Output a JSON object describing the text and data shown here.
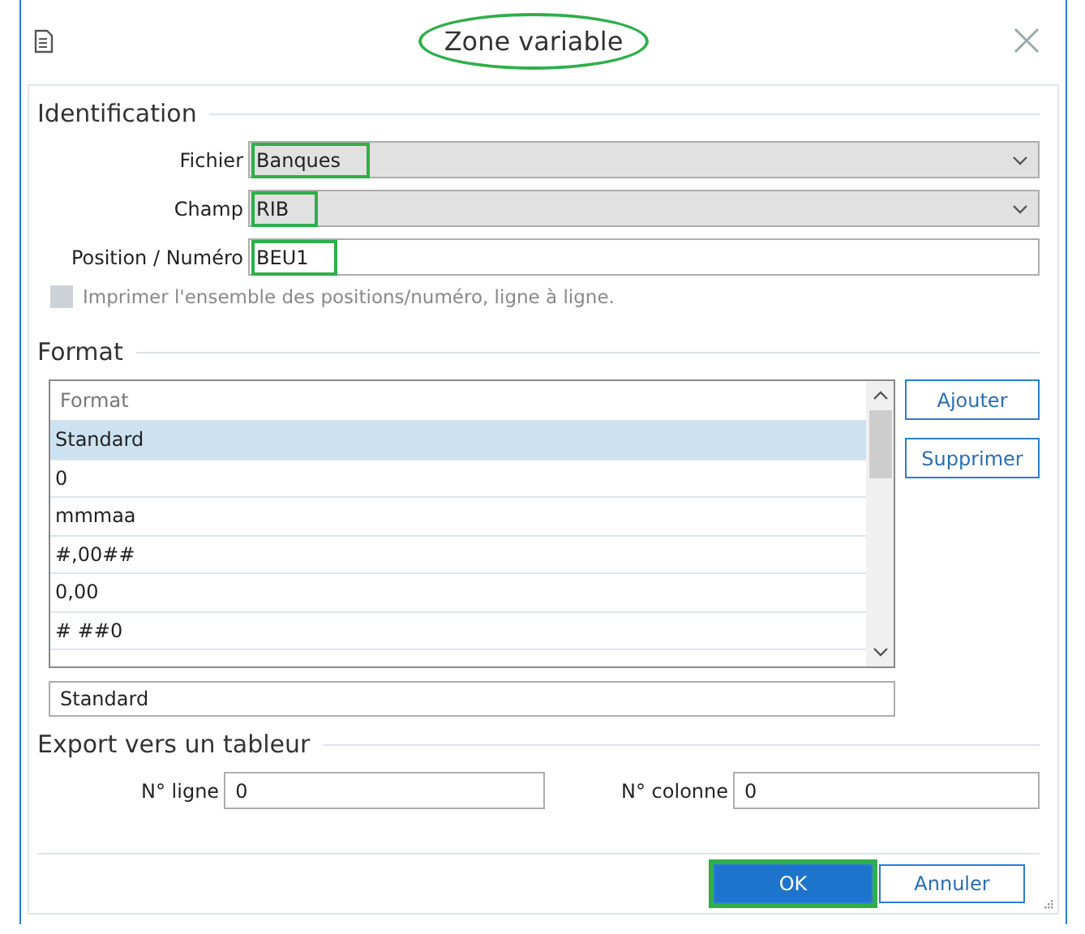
{
  "window": {
    "title": "Zone variable",
    "title_circled": true
  },
  "identification": {
    "heading": "Identification",
    "fields": [
      {
        "kind": "combo",
        "label": "Fichier",
        "value": "Banques",
        "highlighted": true
      },
      {
        "kind": "combo",
        "label": "Champ",
        "value": "RIB",
        "highlighted": true
      },
      {
        "kind": "text",
        "label": "Position / Numéro",
        "value": "BEU1",
        "highlighted": true
      }
    ],
    "checkbox": {
      "label": "Imprimer l'ensemble des positions/numéro, ligne à ligne.",
      "checked": false,
      "disabled": true
    }
  },
  "format": {
    "heading": "Format",
    "list_header": "Format",
    "rows": [
      {
        "text": "Standard",
        "selected": true
      },
      {
        "text": "0",
        "selected": false
      },
      {
        "text": "mmmaa",
        "selected": false
      },
      {
        "text": "#,00##",
        "selected": false
      },
      {
        "text": "0,00",
        "selected": false
      },
      {
        "text": "# ##0",
        "selected": false
      }
    ],
    "buttons": [
      "Ajouter",
      "Supprimer"
    ],
    "value": "Standard"
  },
  "export": {
    "heading": "Export vers un tableur",
    "fields": [
      {
        "label": "N° ligne",
        "value": "0"
      },
      {
        "label": "N° colonne",
        "value": "0"
      }
    ]
  },
  "buttons": [
    {
      "label": "OK",
      "primary": true,
      "highlighted": true
    },
    {
      "label": "Annuler",
      "primary": false,
      "highlighted": false
    }
  ]
}
